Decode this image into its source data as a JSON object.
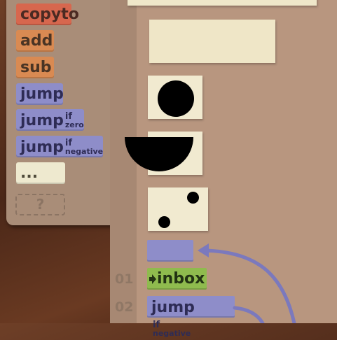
{
  "palette": {
    "copyto": "copyto",
    "add": "add",
    "sub": "sub",
    "jump": "jump",
    "jump_if_zero": {
      "main": "jump",
      "sup": "if",
      "sub": "zero"
    },
    "jump_if_negative": {
      "main": "jump",
      "sup": "if",
      "sub": "negative"
    },
    "comment": "...",
    "unknown": "?"
  },
  "program": {
    "lines": [
      {
        "number": "01",
        "command": "inbox",
        "icon": "arrow-right-icon"
      },
      {
        "number": "02",
        "command": {
          "main": "jump",
          "sup": "if",
          "sub": "negative"
        }
      }
    ]
  },
  "colors": {
    "copyto": "#d7674e",
    "math": "#d98a52",
    "jump": "#8e8dc9",
    "inbox": "#8fbb4e",
    "comment": "#eee9cf"
  }
}
